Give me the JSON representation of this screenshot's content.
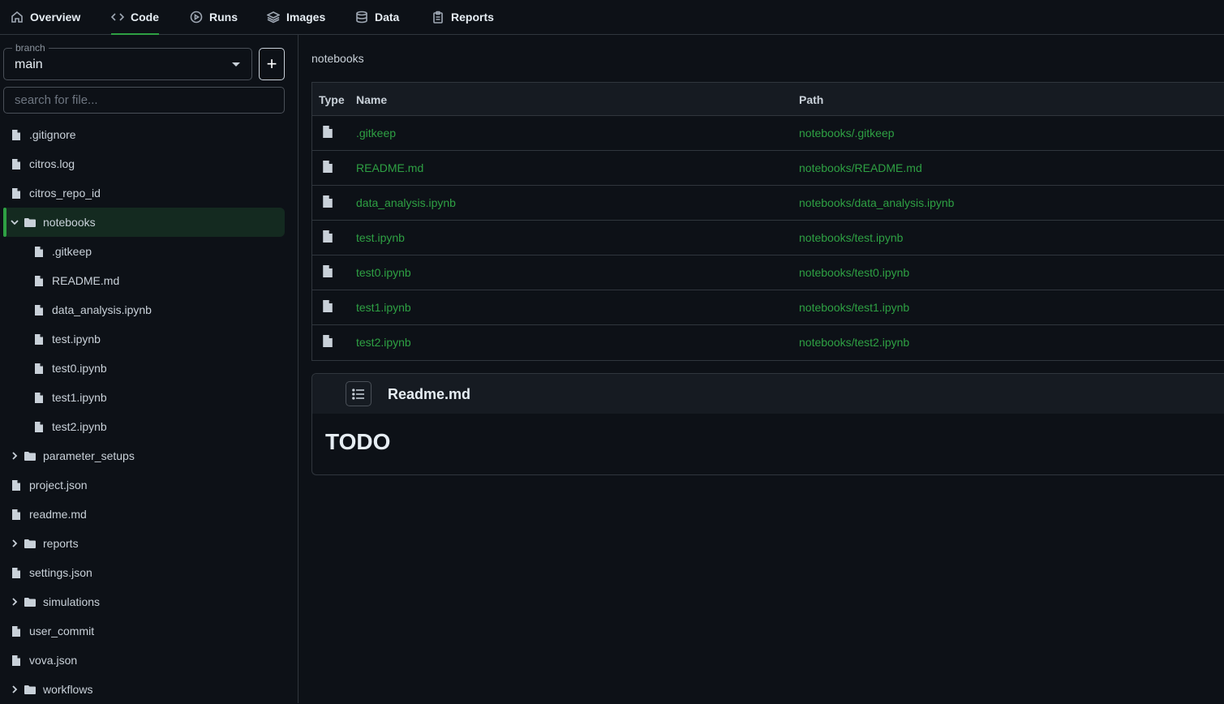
{
  "nav": {
    "tabs": [
      {
        "label": "Overview",
        "icon": "home-icon"
      },
      {
        "label": "Code",
        "icon": "code-icon",
        "active": true
      },
      {
        "label": "Runs",
        "icon": "play-icon"
      },
      {
        "label": "Images",
        "icon": "layers-icon"
      },
      {
        "label": "Data",
        "icon": "database-icon"
      },
      {
        "label": "Reports",
        "icon": "clipboard-icon"
      }
    ]
  },
  "sidebar": {
    "branch_label": "branch",
    "branch_value": "main",
    "add_label": "+",
    "search_placeholder": "search for file...",
    "tree": [
      {
        "label": ".gitignore",
        "type": "file"
      },
      {
        "label": "citros.log",
        "type": "file"
      },
      {
        "label": "citros_repo_id",
        "type": "file"
      },
      {
        "label": "notebooks",
        "type": "folder",
        "expanded": true,
        "selected": true
      },
      {
        "label": ".gitkeep",
        "type": "file",
        "child": true
      },
      {
        "label": "README.md",
        "type": "file",
        "child": true
      },
      {
        "label": "data_analysis.ipynb",
        "type": "file",
        "child": true
      },
      {
        "label": "test.ipynb",
        "type": "file",
        "child": true
      },
      {
        "label": "test0.ipynb",
        "type": "file",
        "child": true
      },
      {
        "label": "test1.ipynb",
        "type": "file",
        "child": true
      },
      {
        "label": "test2.ipynb",
        "type": "file",
        "child": true
      },
      {
        "label": "parameter_setups",
        "type": "folder"
      },
      {
        "label": "project.json",
        "type": "file"
      },
      {
        "label": "readme.md",
        "type": "file"
      },
      {
        "label": "reports",
        "type": "folder"
      },
      {
        "label": "settings.json",
        "type": "file"
      },
      {
        "label": "simulations",
        "type": "folder"
      },
      {
        "label": "user_commit",
        "type": "file"
      },
      {
        "label": "vova.json",
        "type": "file"
      },
      {
        "label": "workflows",
        "type": "folder"
      }
    ]
  },
  "main": {
    "breadcrumb": "notebooks",
    "table": {
      "headers": {
        "type": "Type",
        "name": "Name",
        "path": "Path"
      },
      "rows": [
        {
          "name": ".gitkeep",
          "path": "notebooks/.gitkeep"
        },
        {
          "name": "README.md",
          "path": "notebooks/README.md"
        },
        {
          "name": "data_analysis.ipynb",
          "path": "notebooks/data_analysis.ipynb"
        },
        {
          "name": "test.ipynb",
          "path": "notebooks/test.ipynb"
        },
        {
          "name": "test0.ipynb",
          "path": "notebooks/test0.ipynb"
        },
        {
          "name": "test1.ipynb",
          "path": "notebooks/test1.ipynb"
        },
        {
          "name": "test2.ipynb",
          "path": "notebooks/test2.ipynb"
        }
      ]
    },
    "readme": {
      "title": "Readme.md",
      "heading": "TODO"
    }
  },
  "colors": {
    "accent": "#2ea043",
    "background": "#0d1117",
    "border": "#30363d"
  }
}
